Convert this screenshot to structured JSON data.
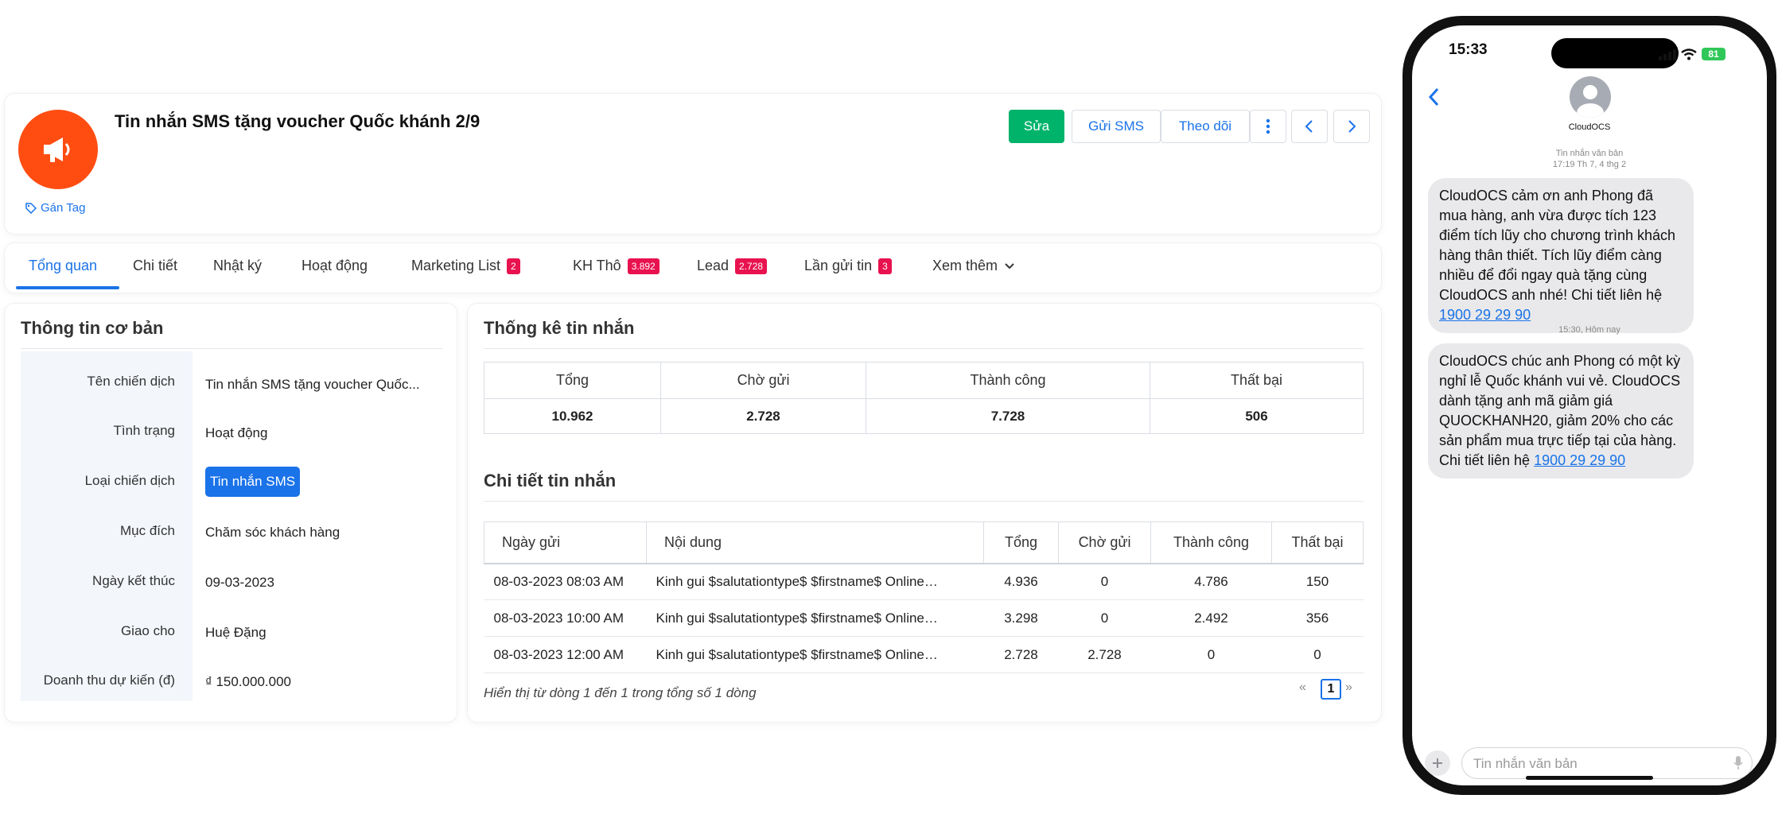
{
  "header": {
    "title": "Tin nhắn SMS tặng voucher Quốc khánh 2/9",
    "tag_label": "Gán Tag",
    "buttons": {
      "edit": "Sửa",
      "send_sms": "Gửi SMS",
      "follow": "Theo dõi"
    }
  },
  "tabs": [
    {
      "label": "Tổng quan",
      "badge": null
    },
    {
      "label": "Chi tiết",
      "badge": null
    },
    {
      "label": "Nhật ký",
      "badge": null
    },
    {
      "label": "Hoạt động",
      "badge": null
    },
    {
      "label": "Marketing List",
      "badge": "2"
    },
    {
      "label": "KH Thô",
      "badge": "3.892"
    },
    {
      "label": "Lead",
      "badge": "2.728"
    },
    {
      "label": "Lần gửi tin",
      "badge": "3"
    },
    {
      "label": "Xem thêm",
      "badge": null
    }
  ],
  "info": {
    "title": "Thông tin cơ bản",
    "rows": [
      {
        "label": "Tên chiến dịch",
        "value": "Tin nhắn SMS tặng voucher Quốc..."
      },
      {
        "label": "Tình trạng",
        "value": "Hoạt động"
      },
      {
        "label": "Loại chiến dịch",
        "value": "Tin nhắn SMS"
      },
      {
        "label": "Mục đích",
        "value": "Chăm sóc khách hàng"
      },
      {
        "label": "Ngày kết thúc",
        "value": "09-03-2023"
      },
      {
        "label": "Giao cho",
        "value": "Huệ Đặng"
      },
      {
        "label": "Doanh thu dự kiến (đ)",
        "value": "₫ 150.000.000"
      }
    ]
  },
  "stats": {
    "title": "Thống kê tin nhắn",
    "headers": [
      "Tổng",
      "Chờ gửi",
      "Thành công",
      "Thất bại"
    ],
    "values": [
      "10.962",
      "2.728",
      "7.728",
      "506"
    ]
  },
  "detail": {
    "title": "Chi tiết tin nhắn",
    "headers": [
      "Ngày gửi",
      "Nội dung",
      "Tổng",
      "Chờ gửi",
      "Thành công",
      "Thất bại"
    ],
    "rows": [
      [
        "08-03-2023 08:03 AM",
        "Kinh gui $salutationtype$ $firstname$ Online…",
        "4.936",
        "0",
        "4.786",
        "150"
      ],
      [
        "08-03-2023 10:00 AM",
        "Kinh gui $salutationtype$ $firstname$ Online…",
        "3.298",
        "0",
        "2.492",
        "356"
      ],
      [
        "08-03-2023 12:00 AM",
        "Kinh gui $salutationtype$ $firstname$ Online…",
        "2.728",
        "2.728",
        "0",
        "0"
      ]
    ],
    "footer": "Hiển thị từ dòng 1 đến 1 trong tổng số 1 dòng",
    "pager": {
      "prev": "«",
      "page": "1",
      "next": "»"
    }
  },
  "phone": {
    "time": "15:33",
    "battery": "81",
    "contact": "CloudOCS",
    "meta1_line1": "Tin nhắn văn bản",
    "meta1_line2": "17:19 Th 7, 4 thg 2",
    "msg1_text": "CloudOCS cảm ơn anh Phong đã mua hàng, anh vừa được tích 123 điểm tích lũy cho chương trình khách hàng thân thiết. Tích lũy điểm càng nhiều để đổi ngay quà tặng cùng CloudOCS anh nhé! Chi tiết liên hệ ",
    "msg1_link": "1900 29 29 90",
    "meta2": "15:30, Hôm nay",
    "msg2_text": "CloudOCS chúc anh Phong có một kỳ nghỉ lễ Quốc khánh vui vẻ. CloudOCS dành tặng anh mã giảm giá QUOCKHANH20, giảm 20% cho các sản phẩm mua trực tiếp tại của hàng. Chi tiết liên hệ ",
    "msg2_link": "1900 29 29 90",
    "input_placeholder": "Tin nhắn văn bản"
  }
}
